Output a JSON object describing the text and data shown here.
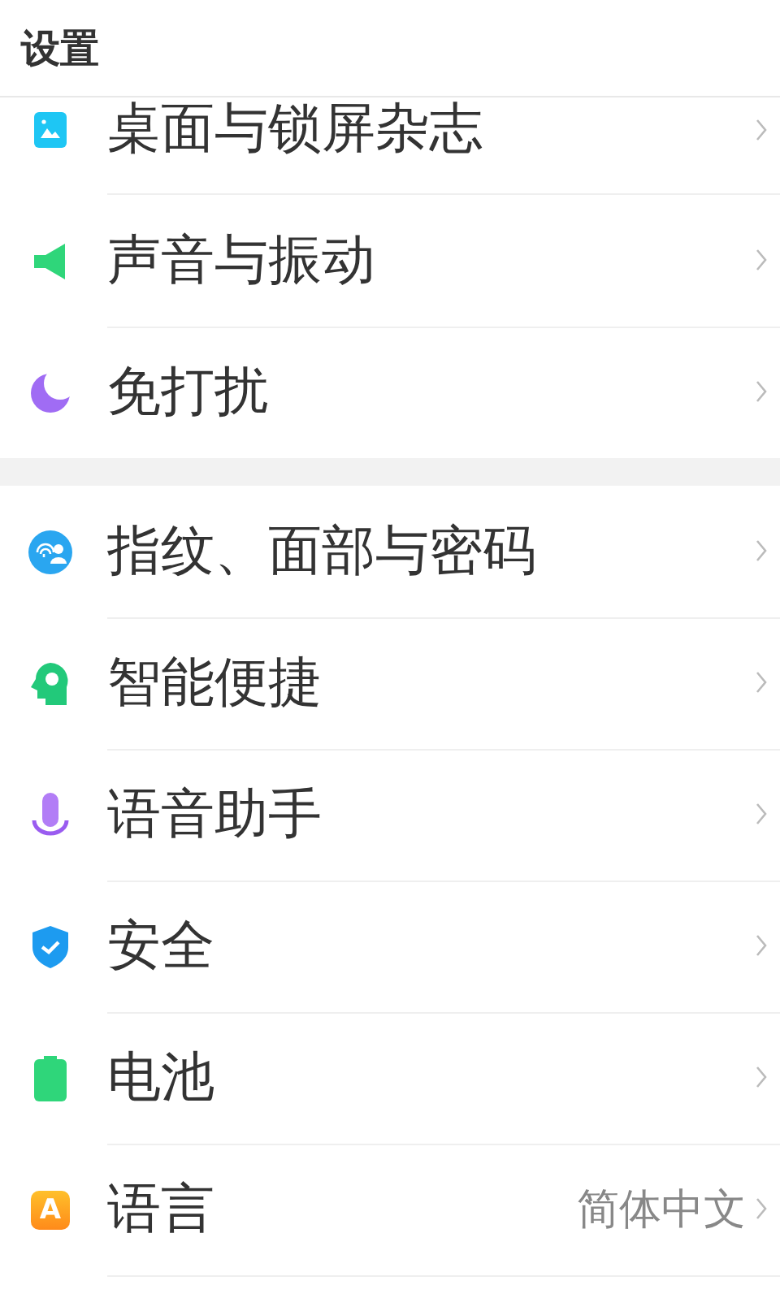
{
  "title": "设置",
  "sections": [
    {
      "items": [
        {
          "kind": "wallpaper",
          "label": "桌面与锁屏杂志"
        },
        {
          "kind": "sound",
          "label": "声音与振动"
        },
        {
          "kind": "dnd",
          "label": "免打扰"
        }
      ]
    },
    {
      "items": [
        {
          "kind": "biometric",
          "label": "指纹、面部与密码"
        },
        {
          "kind": "smart",
          "label": "智能便捷"
        },
        {
          "kind": "voice",
          "label": "语音助手"
        },
        {
          "kind": "security",
          "label": "安全"
        },
        {
          "kind": "battery",
          "label": "电池"
        },
        {
          "kind": "language",
          "icon_text": "A",
          "label": "语言",
          "value": "简体中文"
        }
      ]
    }
  ]
}
